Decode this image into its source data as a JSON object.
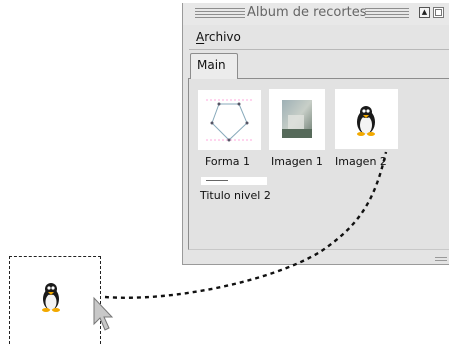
{
  "window": {
    "title": "Album de recortes"
  },
  "menu": {
    "file_label": "Archivo",
    "file_accel": "A",
    "file_rest": "rchivo"
  },
  "tabs": [
    {
      "label": "Main"
    }
  ],
  "items": [
    {
      "label": "Forma 1",
      "icon": "pentagon-shape-icon"
    },
    {
      "label": "Imagen 1",
      "icon": "photo-thumbnail-icon"
    },
    {
      "label": "Imagen 2",
      "icon": "penguin-icon"
    },
    {
      "label": "Titulo nivel 2",
      "icon": "heading-thumbnail-icon"
    }
  ],
  "colors": {
    "background": "#ffffff",
    "window_bg": "#e4e4e4",
    "drag_line": "#111111"
  }
}
